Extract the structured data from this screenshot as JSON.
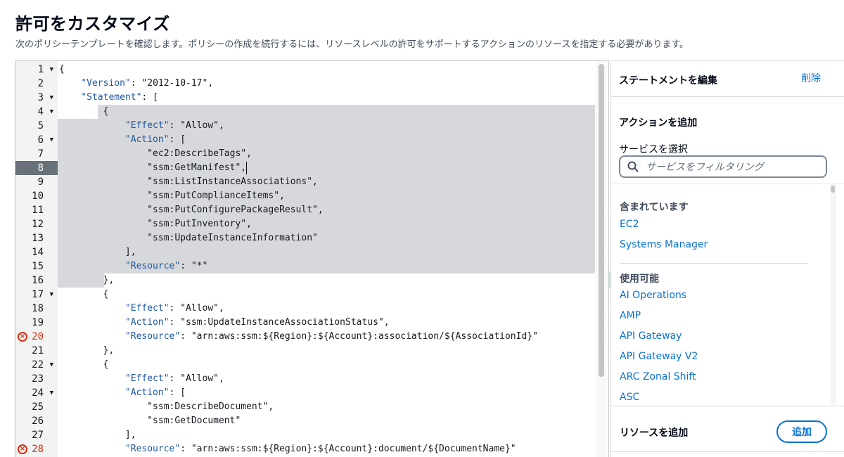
{
  "header": {
    "title": "許可をカスタマイズ",
    "description": "次のポリシーテンプレートを確認します。ポリシーの作成を続行するには、リソースレベルの許可をサポートするアクションのリソースを指定する必要があります。"
  },
  "editor": {
    "active_line": 8,
    "error_lines": [
      20,
      28
    ],
    "lines": [
      {
        "n": "1",
        "fold": true,
        "text": "{"
      },
      {
        "n": "2",
        "fold": false,
        "text": "    \"Version\": \"2012-10-17\","
      },
      {
        "n": "3",
        "fold": true,
        "text": "    \"Statement\": ["
      },
      {
        "n": "4",
        "fold": true,
        "text": "        {"
      },
      {
        "n": "5",
        "fold": false,
        "text": "            \"Effect\": \"Allow\","
      },
      {
        "n": "6",
        "fold": true,
        "text": "            \"Action\": ["
      },
      {
        "n": "7",
        "fold": false,
        "text": "                \"ec2:DescribeTags\","
      },
      {
        "n": "8",
        "fold": false,
        "text": "                \"ssm:GetManifest\","
      },
      {
        "n": "9",
        "fold": false,
        "text": "                \"ssm:ListInstanceAssociations\","
      },
      {
        "n": "10",
        "fold": false,
        "text": "                \"ssm:PutComplianceItems\","
      },
      {
        "n": "11",
        "fold": false,
        "text": "                \"ssm:PutConfigurePackageResult\","
      },
      {
        "n": "12",
        "fold": false,
        "text": "                \"ssm:PutInventory\","
      },
      {
        "n": "13",
        "fold": false,
        "text": "                \"ssm:UpdateInstanceInformation\""
      },
      {
        "n": "14",
        "fold": false,
        "text": "            ],"
      },
      {
        "n": "15",
        "fold": false,
        "text": "            \"Resource\": \"*\""
      },
      {
        "n": "16",
        "fold": false,
        "text": "        },"
      },
      {
        "n": "17",
        "fold": true,
        "text": "        {"
      },
      {
        "n": "18",
        "fold": false,
        "text": "            \"Effect\": \"Allow\","
      },
      {
        "n": "19",
        "fold": false,
        "text": "            \"Action\": \"ssm:UpdateInstanceAssociationStatus\","
      },
      {
        "n": "20",
        "fold": false,
        "text": "            \"Resource\": \"arn:aws:ssm:${Region}:${Account}:association/${AssociationId}\""
      },
      {
        "n": "21",
        "fold": false,
        "text": "        },"
      },
      {
        "n": "22",
        "fold": true,
        "text": "        {"
      },
      {
        "n": "23",
        "fold": false,
        "text": "            \"Effect\": \"Allow\","
      },
      {
        "n": "24",
        "fold": true,
        "text": "            \"Action\": ["
      },
      {
        "n": "25",
        "fold": false,
        "text": "                \"ssm:DescribeDocument\","
      },
      {
        "n": "26",
        "fold": false,
        "text": "                \"ssm:GetDocument\""
      },
      {
        "n": "27",
        "fold": false,
        "text": "            ],"
      },
      {
        "n": "28",
        "fold": false,
        "text": "            \"Resource\": \"arn:aws:ssm:${Region}:${Account}:document/${DocumentName}\""
      }
    ]
  },
  "panel": {
    "title": "ステートメントを編集",
    "delete_label": "削除",
    "add_action_title": "アクションを追加",
    "service_label": "サービスを選択",
    "search_placeholder": "サービスをフィルタリング",
    "included_label": "含まれています",
    "included_services": [
      "EC2",
      "Systems Manager"
    ],
    "available_label": "使用可能",
    "available_services": [
      "AI Operations",
      "AMP",
      "API Gateway",
      "API Gateway V2",
      "ARC Zonal Shift",
      "ASC"
    ],
    "add_resource_title": "リソースを追加",
    "add_button_label": "追加"
  }
}
